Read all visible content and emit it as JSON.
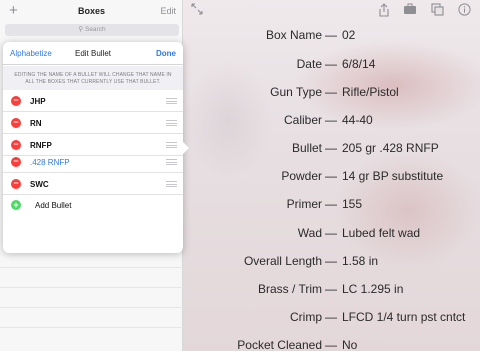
{
  "toolbar": {
    "icons": [
      "expand-icon",
      "share-icon",
      "briefcase-icon",
      "copy-icon",
      "info-icon"
    ]
  },
  "boxes_pane": {
    "title": "Boxes",
    "edit_label": "Edit",
    "add_symbol": "+",
    "search_placeholder": "Search"
  },
  "popover": {
    "alphabetize_label": "Alphabetize",
    "title": "Edit Bullet",
    "done_label": "Done",
    "note": "EDITING THE NAME OF A BULLET WILL CHANGE THAT NAME IN ALL THE BOXES THAT CURRENTLY USE THAT BULLET.",
    "bullets": [
      {
        "name": "JHP"
      },
      {
        "name": "RN"
      },
      {
        "name": "RNFP"
      },
      {
        "name": ".428 RNFP"
      },
      {
        "name": "SWC"
      }
    ],
    "add_label": "Add Bullet"
  },
  "details": [
    {
      "label": "Box Name",
      "value": "02"
    },
    {
      "label": "Date",
      "value": "6/8/14"
    },
    {
      "label": "Gun Type",
      "value": "Rifle/Pistol"
    },
    {
      "label": "Caliber",
      "value": "44-40"
    },
    {
      "label": "Bullet",
      "value": "205 gr .428 RNFP"
    },
    {
      "label": "Powder",
      "value": "14 gr BP substitute"
    },
    {
      "label": "Primer",
      "value": "155"
    },
    {
      "label": "Wad",
      "value": "Lubed felt wad"
    },
    {
      "label": "Overall Length",
      "value": "1.58 in"
    },
    {
      "label": "Brass / Trim",
      "value": "LC 1.295 in"
    },
    {
      "label": "Crimp",
      "value": "LFCD 1/4 turn pst cntct"
    },
    {
      "label": "Pocket Cleaned",
      "value": "No"
    }
  ],
  "separator": "—",
  "colors": {
    "accent": "#2f7ae5",
    "delete": "#fc3d39",
    "add": "#4cd964"
  }
}
